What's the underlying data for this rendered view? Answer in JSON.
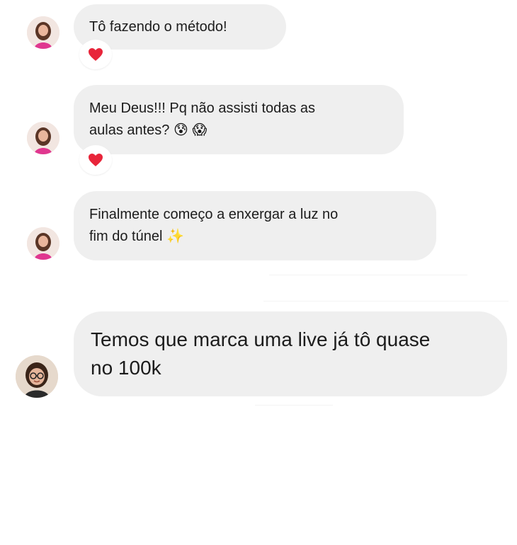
{
  "messages": [
    {
      "text": "Tô fazendo o método!",
      "reaction": "heart-icon",
      "avatar": "avatar-woman-pink"
    },
    {
      "text": "Meu Deus!!! Pq não assisti todas as\naulas  antes?",
      "emojis": [
        "😰",
        "😱"
      ],
      "reaction": "heart-icon",
      "avatar": "avatar-woman-pink"
    },
    {
      "text": "Finalmente começo a enxergar a luz no\nfim do túnel",
      "emojis": [
        "✨"
      ],
      "avatar": "avatar-woman-pink"
    },
    {
      "text": "Temos que marca uma live já tô quase\nno 100k",
      "avatar": "avatar-woman-glasses"
    }
  ],
  "colors": {
    "bubble": "#efefef",
    "text": "#1c1c1c",
    "heart": "#e8253a",
    "background": "#ffffff"
  }
}
